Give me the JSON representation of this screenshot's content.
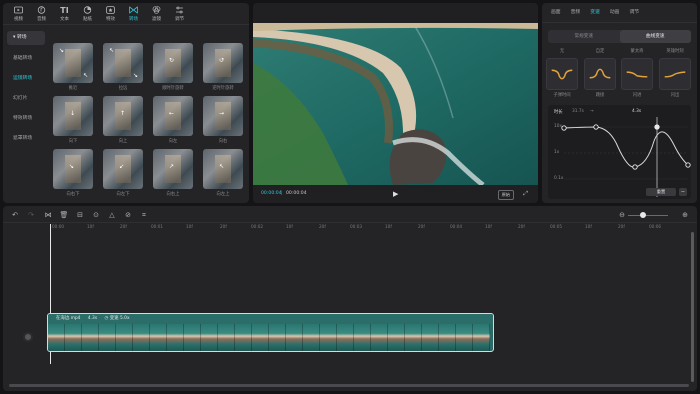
{
  "toolbar": {
    "items": [
      {
        "label": "视频",
        "icon": "video-icon"
      },
      {
        "label": "音频",
        "icon": "audio-icon"
      },
      {
        "label": "文本",
        "icon": "text-icon"
      },
      {
        "label": "贴纸",
        "icon": "sticker-icon"
      },
      {
        "label": "特效",
        "icon": "effects-icon"
      },
      {
        "label": "转场",
        "icon": "transition-icon"
      },
      {
        "label": "滤镜",
        "icon": "filter-icon"
      },
      {
        "label": "调节",
        "icon": "adjust-icon"
      }
    ]
  },
  "sidebar": {
    "items": [
      "转场",
      "基础转场",
      "运镜转场",
      "幻灯片",
      "特效转场",
      "遮罩转场"
    ]
  },
  "transitions": {
    "section_title": "运镜转场",
    "items": [
      "推近",
      "拉远",
      "顺时针旋转",
      "逆时针旋转",
      "向下",
      "向上",
      "向左",
      "向右",
      "向右下",
      "向左下",
      "向右上",
      "向左上"
    ]
  },
  "player": {
    "current_time": "00:00:04",
    "total_time": "00:00:04",
    "original_button": "原始"
  },
  "props": {
    "tabs": [
      "画面",
      "音频",
      "变速",
      "动画",
      "调节"
    ],
    "segment": [
      "常规变速",
      "曲线变速"
    ],
    "presets": [
      "无",
      "自定",
      "蒙太奇",
      "英雄时刻"
    ],
    "presets_row2": [
      "子弹时间",
      "跳接",
      "闪进",
      "闪出"
    ],
    "editor": {
      "duration_label": "时长",
      "original_duration": "31.7s",
      "new_duration": "4.3s",
      "y_labels": [
        "10x",
        "1x",
        "0.1x"
      ],
      "reset_button": "重置"
    }
  },
  "timeline": {
    "ruler": [
      "00:00",
      "10f",
      "20f",
      "00:01",
      "10f",
      "20f",
      "00:02",
      "10f",
      "20f",
      "00:03",
      "10f",
      "20f",
      "00:04",
      "10f",
      "20f",
      "00:05",
      "10f",
      "20f",
      "00:06"
    ],
    "clip": {
      "name": "在海边.mp4",
      "duration": "4.3s",
      "speed_label": "变速 5.0x"
    }
  }
}
